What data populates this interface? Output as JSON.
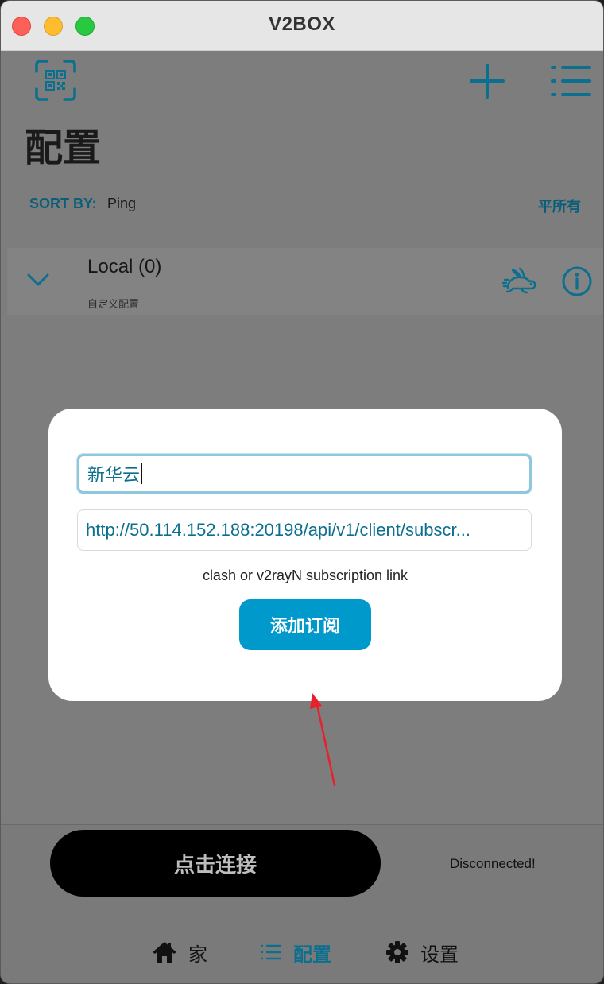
{
  "window": {
    "title": "V2BOX"
  },
  "header": {
    "page_title": "配置"
  },
  "sort": {
    "label": "SORT BY:",
    "value": "Ping",
    "right_action": "平所有"
  },
  "group": {
    "name": "Local (0)",
    "subtitle": "自定义配置"
  },
  "dialog": {
    "name_value": "新华云",
    "url_value": "http://50.114.152.188:20198/api/v1/client/subscr...",
    "hint": "clash or v2rayN subscription link",
    "button_label": "添加订阅"
  },
  "bottom": {
    "connect_label": "点击连接",
    "status": "Disconnected!"
  },
  "tabs": [
    {
      "label": "家",
      "icon": "home-icon"
    },
    {
      "label": "配置",
      "icon": "list-icon",
      "active": true
    },
    {
      "label": "设置",
      "icon": "gear-icon"
    }
  ],
  "colors": {
    "accent": "#0099cc",
    "dark_accent": "#0b5e7a",
    "annotation_arrow": "#e8202b"
  }
}
